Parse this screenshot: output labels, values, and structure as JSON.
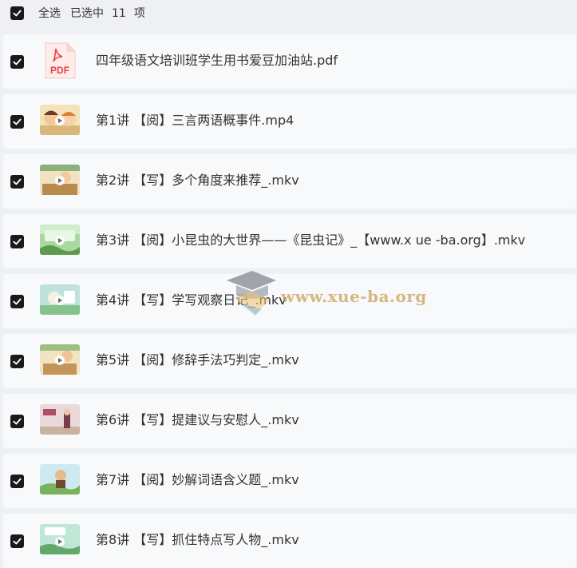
{
  "header": {
    "select_all_label": "全选",
    "selected_label": "已选中",
    "selected_count": "11",
    "unit_label": "项"
  },
  "files": [
    {
      "name": "四年级语文培训班学生用书爱豆加油站.pdf",
      "type": "pdf",
      "icon": "pdf-file-icon"
    },
    {
      "name": "第1讲 【阅】三言两语概事件.mp4",
      "type": "video",
      "icon": "video-thumbnail"
    },
    {
      "name": "第2讲 【写】多个角度来推荐_.mkv",
      "type": "video",
      "icon": "video-thumbnail"
    },
    {
      "name": "第3讲 【阅】小昆虫的大世界——《昆虫记》_【www.x ue -ba.org】.mkv",
      "type": "video",
      "icon": "video-thumbnail"
    },
    {
      "name": "第4讲 【写】学写观察日记_.mkv",
      "type": "video",
      "icon": "video-thumbnail"
    },
    {
      "name": "第5讲 【阅】修辞手法巧判定_.mkv",
      "type": "video",
      "icon": "video-thumbnail"
    },
    {
      "name": "第6讲 【写】提建议与安慰人_.mkv",
      "type": "video",
      "icon": "video-thumbnail"
    },
    {
      "name": "第7讲 【阅】妙解词语含义题_.mkv",
      "type": "video",
      "icon": "video-thumbnail"
    },
    {
      "name": "第8讲 【写】抓住特点写人物_.mkv",
      "type": "video",
      "icon": "video-thumbnail"
    }
  ],
  "pdf_icon_text": "PDF",
  "watermark": "www.xue-ba.org",
  "colors": {
    "checkbox": "#1a1a1a",
    "row_bg": "#f8f9fa",
    "page_bg": "#eef0f3",
    "pdf_red": "#e8453c"
  }
}
